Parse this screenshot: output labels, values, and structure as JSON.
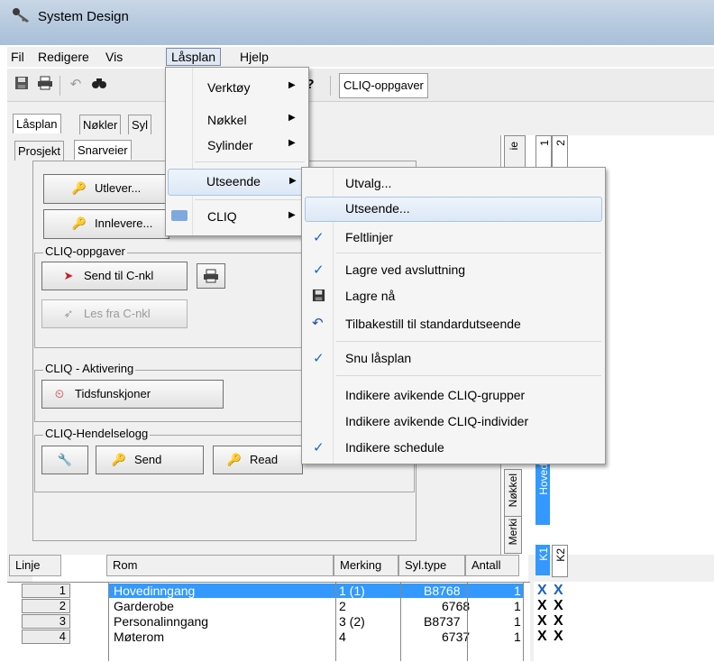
{
  "window": {
    "title": "System Design"
  },
  "menubar": {
    "items": [
      "Fil",
      "Redigere",
      "Vis",
      "Låsplan",
      "Hjelp"
    ]
  },
  "toolbar": {
    "cliq_tasks": "CLIQ-oppgaver"
  },
  "tabs": {
    "main": [
      "Låsplan",
      "Nøkler",
      "Syl"
    ],
    "sub": [
      "Prosjekt",
      "Snarveier"
    ]
  },
  "panel": {
    "utlever": "Utlever...",
    "innlevere": "Innlevere...",
    "cliq_tasks_group": "CLIQ-oppgaver",
    "send_cnkl": "Send til C-nkl",
    "read_cnkl": "Les fra C-nkl",
    "activation_group": "CLIQ - Aktivering",
    "time_functions": "Tidsfunskjoner",
    "event_log_group": "CLIQ-Hendelselogg",
    "send": "Send",
    "read": "Read"
  },
  "lasplan_menu": {
    "items": [
      {
        "label": "Verktøy",
        "submenu": true
      },
      {
        "label": "Nøkkel",
        "submenu": true
      },
      {
        "label": "Sylinder",
        "submenu": true
      },
      {
        "label": "Utseende",
        "submenu": true,
        "highlighted": true
      },
      {
        "label": "CLIQ",
        "submenu": true,
        "icon": "cliq-icon"
      }
    ]
  },
  "utseende_menu": {
    "items": [
      {
        "label": "Utvalg...",
        "checked": false
      },
      {
        "label": "Utseende...",
        "checked": false,
        "highlighted": true
      },
      {
        "label": "Feltlinjer",
        "checked": true
      },
      {
        "label": "Lagre ved  avsluttning",
        "checked": true
      },
      {
        "label": "Lagre nå",
        "checked": false,
        "icon": "save-icon"
      },
      {
        "label": "Tilbakestill til standardutseende",
        "checked": false,
        "icon": "undo-icon"
      },
      {
        "label": "Snu låsplan",
        "checked": true
      },
      {
        "label": "Indikere avikende CLIQ-grupper",
        "checked": false
      },
      {
        "label": "Indikere avikende CLIQ-individer",
        "checked": false
      },
      {
        "label": "Indikere schedule",
        "checked": true
      }
    ]
  },
  "right_headers": {
    "col1": "1",
    "col2": "2",
    "partial": "ie",
    "vertical_hoved": "Hoved",
    "vertical_nokkel": "Nøkkel",
    "vertical_merki": "Merki",
    "k1": "K1",
    "k2": "K2"
  },
  "grid": {
    "columns": [
      "Linje",
      "Rom",
      "Merking",
      "Syl.type",
      "Antall"
    ],
    "rows": [
      {
        "linje": "1",
        "rom": "Hovedinngang",
        "merking": "1 (1)",
        "syltype": "B8768",
        "antall": "1",
        "selected": true
      },
      {
        "linje": "2",
        "rom": "Garderobe",
        "merking": "2",
        "syltype": "6768",
        "antall": "1",
        "selected": false
      },
      {
        "linje": "3",
        "rom": "Personalinngang",
        "merking": "3 (2)",
        "syltype": "B8737",
        "antall": "1",
        "selected": false
      },
      {
        "linje": "4",
        "rom": "Møterom",
        "merking": "4",
        "syltype": "6737",
        "antall": "1",
        "selected": false
      }
    ],
    "mark": "X"
  }
}
